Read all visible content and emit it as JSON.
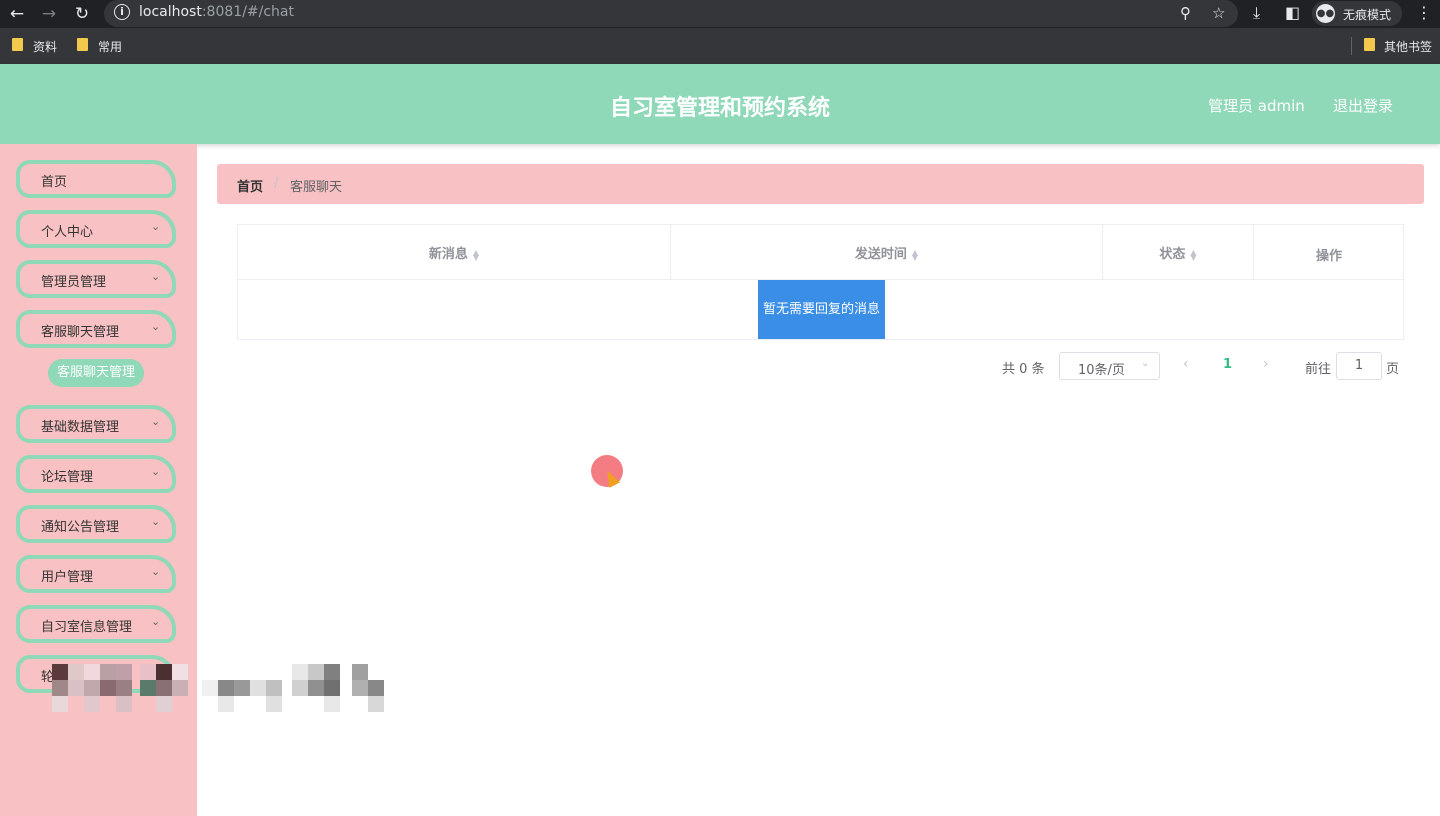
{
  "browser": {
    "url_host": "localhost",
    "url_rest": ":8081/#/chat",
    "incognito_label": "无痕模式",
    "bookmarks": [
      "资料",
      "常用"
    ],
    "other_bookmarks": "其他书签"
  },
  "header": {
    "title": "自习室管理和预约系统",
    "user": "管理员 admin",
    "logout": "退出登录"
  },
  "sidebar": {
    "items": [
      {
        "label": "首页"
      },
      {
        "label": "个人中心"
      },
      {
        "label": "管理员管理"
      },
      {
        "label": "客服聊天管理"
      },
      {
        "label": "基础数据管理"
      },
      {
        "label": "论坛管理"
      },
      {
        "label": "通知公告管理"
      },
      {
        "label": "用户管理"
      },
      {
        "label": "自习室信息管理"
      },
      {
        "label": "轮"
      }
    ],
    "active_submenu": "客服聊天管理"
  },
  "breadcrumb": {
    "home": "首页",
    "separator": "/",
    "current": "客服聊天"
  },
  "table": {
    "columns": [
      "新消息",
      "发送时间",
      "状态",
      "操作"
    ],
    "empty_text": "暂无需要回复的消息"
  },
  "pagination": {
    "total": "共 0 条",
    "page_size": "10条/页",
    "current_page": "1",
    "goto_label": "前往",
    "goto_value": "1",
    "page_unit": "页"
  },
  "colors": {
    "header_bg": "#8fd8b8",
    "sidebar_bg": "#f8c1c3",
    "accent_blue": "#3a8ee6"
  }
}
